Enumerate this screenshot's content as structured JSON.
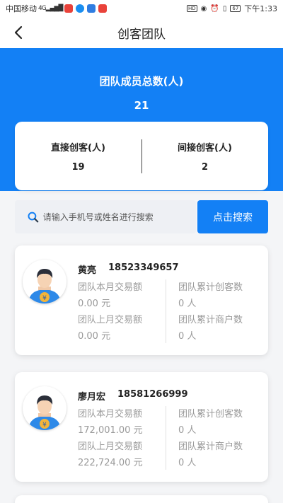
{
  "status_bar": {
    "carrier": "中国移动",
    "signal": "4G",
    "hd": "HD",
    "battery": "67",
    "time": "下午1:33"
  },
  "header": {
    "title": "创客团队"
  },
  "summary": {
    "total_label": "团队成员总数(人)",
    "total_value": "21",
    "direct_label": "直接创客(人)",
    "direct_value": "19",
    "indirect_label": "间接创客(人)",
    "indirect_value": "2"
  },
  "search": {
    "placeholder": "请输入手机号或姓名进行搜索",
    "button_label": "点击搜索"
  },
  "members": [
    {
      "name": "黄亮",
      "phone": "18523349657",
      "this_month_label": "团队本月交易额",
      "this_month_value": "0.00 元",
      "last_month_label": "团队上月交易额",
      "last_month_value": "0.00 元",
      "makers_label": "团队累计创客数",
      "makers_value": "0 人",
      "merchants_label": "团队累计商户数",
      "merchants_value": "0 人"
    },
    {
      "name": "廖月宏",
      "phone": "18581266999",
      "this_month_label": "团队本月交易额",
      "this_month_value": "172,001.00 元",
      "last_month_label": "团队上月交易额",
      "last_month_value": "222,724.00 元",
      "makers_label": "团队累计创客数",
      "makers_value": "0 人",
      "merchants_label": "团队累计商户数",
      "merchants_value": "0 人"
    }
  ],
  "colors": {
    "primary": "#1380f5",
    "background": "#f4f5f7",
    "muted_text": "#9a9a9a"
  }
}
